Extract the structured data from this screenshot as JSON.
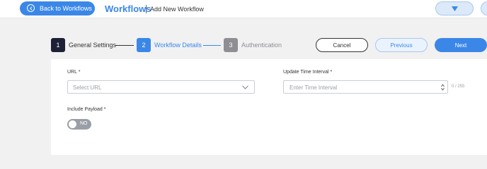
{
  "header": {
    "back_label": "Back to Workflows",
    "title": "Workflows",
    "subtitle": "Add New Workflow",
    "accent_color": "#3b87e8"
  },
  "steps": [
    {
      "number": "1",
      "label": "General Settings",
      "state": "completed"
    },
    {
      "number": "2",
      "label": "Workflow Details",
      "state": "active"
    },
    {
      "number": "3",
      "label": "Authentication",
      "state": "pending"
    }
  ],
  "actions": {
    "cancel": "Cancel",
    "previous": "Previous",
    "next": "Next"
  },
  "form": {
    "url": {
      "label": "URL *",
      "placeholder": "Select URL",
      "value": ""
    },
    "interval": {
      "label": "Update Time Interval *",
      "placeholder": "Enter Time Interval",
      "value": "",
      "counter": "0 / 255"
    },
    "payload": {
      "label": "Include Payload *",
      "toggle_text": "NO",
      "enabled": false
    }
  },
  "icons": {
    "back": "chevron-left-icon",
    "dropdown": "triangle-down-icon",
    "select_chevron": "chevron-down-icon",
    "spinner": "number-spinner-icon"
  }
}
